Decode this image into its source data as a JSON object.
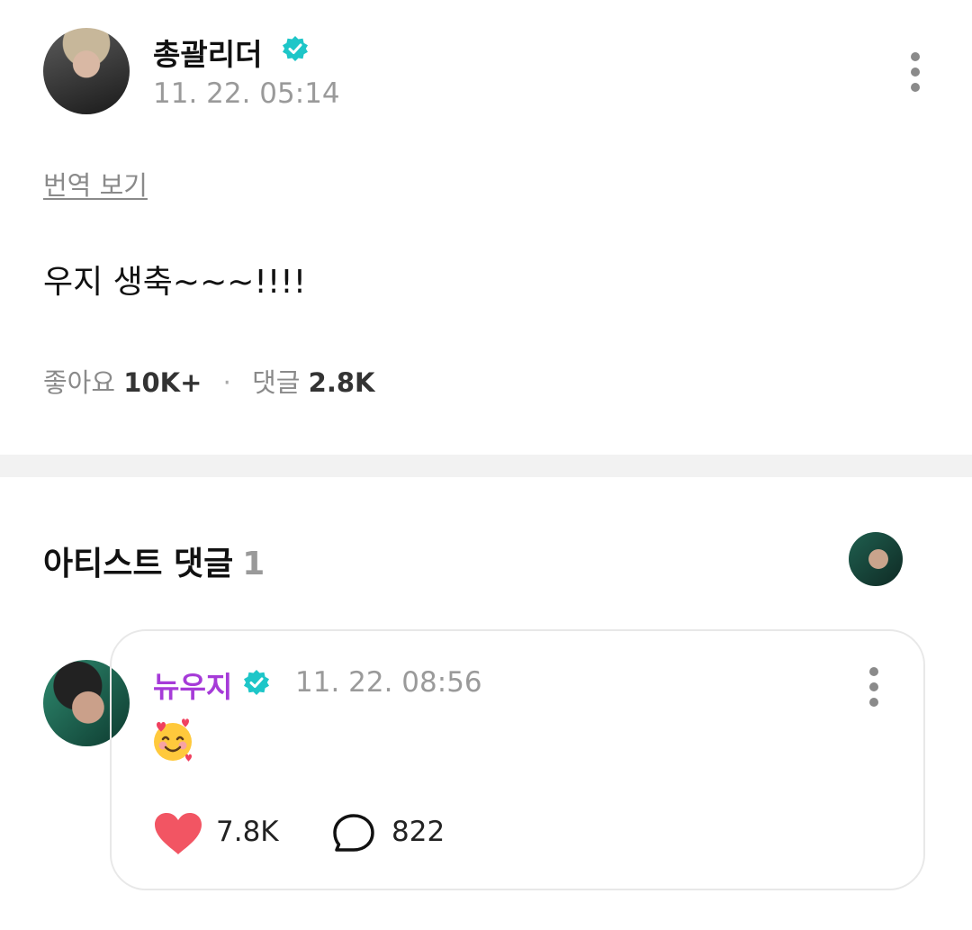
{
  "post": {
    "author": "총괄리더",
    "timestamp": "11. 22. 05:14",
    "translate_link": "번역 보기",
    "body": "우지 생축~~~!!!!",
    "likes_label": "좋아요",
    "likes_count": "10K+",
    "comments_label": "댓글",
    "comments_count": "2.8K"
  },
  "artist_comments": {
    "title": "아티스트 댓글",
    "count": "1"
  },
  "comment": {
    "author": "뉴우지",
    "timestamp": "11. 22. 08:56",
    "content_emoji": "smiling-face-with-hearts",
    "likes": "7.8K",
    "replies": "822"
  },
  "colors": {
    "verified_badge": "#1ec6c8",
    "artist_name": "#a63bd8",
    "like_heart": "#f25563",
    "muted_text": "#9a9a9a",
    "divider": "#f2f2f2"
  },
  "icons": [
    "verified-badge-icon",
    "more-options-icon",
    "heart-icon",
    "speech-bubble-icon"
  ]
}
